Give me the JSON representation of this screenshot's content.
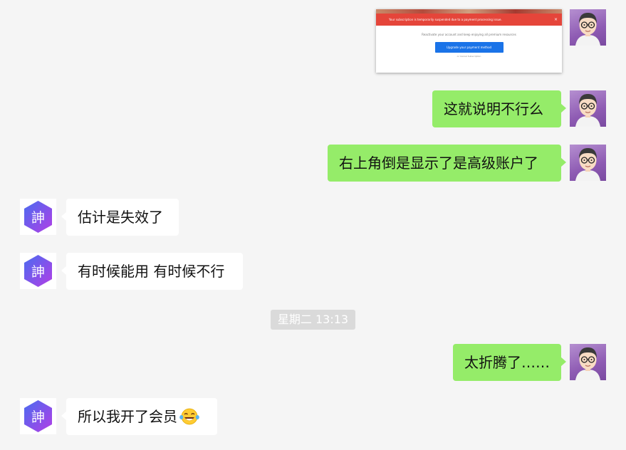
{
  "messages": {
    "m1": {
      "sender": "me",
      "type": "image"
    },
    "m2": {
      "sender": "me",
      "text": "这就说明不行么"
    },
    "m3": {
      "sender": "me",
      "text": "右上角倒是显示了是高级账户了"
    },
    "m4": {
      "sender": "them",
      "text": "估计是失效了"
    },
    "m5": {
      "sender": "them",
      "text": "有时候能用 有时候不行"
    },
    "m6": {
      "sender": "me",
      "text": "太折腾了……"
    },
    "m7": {
      "sender": "them",
      "text": "所以我开了会员",
      "emoji": "tears-of-joy-emoji"
    }
  },
  "timestamp": "星期二 13:13",
  "screenshot": {
    "banner": "Your subscription is temporarily suspended due to a payment processing issue.",
    "description": "Reactivate your account and keep enjoying all premium resources",
    "button": "Upgrade your payment method",
    "cancel": "or Cancel Subscription"
  },
  "avatars": {
    "me": "cartoon-man-with-glasses",
    "them": "hexagon-logo-purple"
  },
  "bot_logo_text": "訷",
  "colors": {
    "background": "#f5f5f5",
    "my_bubble": "#95ec69",
    "their_bubble": "#ffffff",
    "timestamp_bg": "#dadada",
    "alert_red": "#e5453a",
    "button_blue": "#1a73e8"
  }
}
